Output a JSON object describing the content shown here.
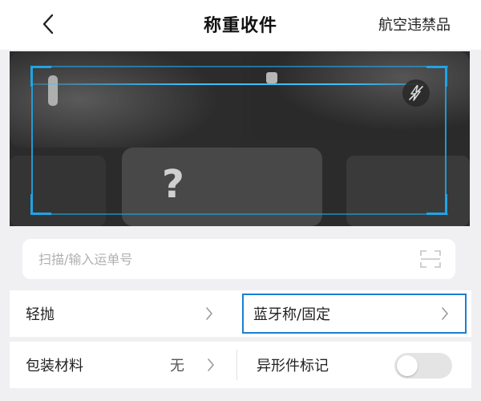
{
  "header": {
    "title": "称重收件",
    "right_link": "航空违禁品"
  },
  "camera": {
    "scan_color": "#1fa4e6",
    "flash_icon": "flash-off-icon"
  },
  "waybill_input": {
    "placeholder": "扫描/输入运单号",
    "value": "",
    "icon": "scan-icon"
  },
  "options": {
    "light_throw": {
      "label": "轻抛"
    },
    "bluetooth_scale": {
      "label": "蓝牙称/固定"
    },
    "packaging": {
      "label": "包装材料",
      "value": "无"
    },
    "irregular": {
      "label": "异形件标记",
      "enabled": false
    }
  },
  "colors": {
    "accent": "#1a7fd0",
    "toggle_off": "#e4e4e4"
  }
}
